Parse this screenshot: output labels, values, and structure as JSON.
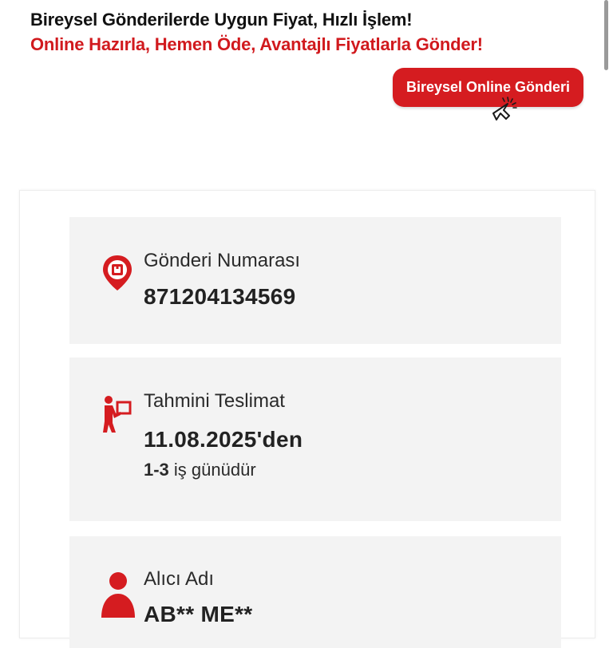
{
  "promo": {
    "title": "Bireysel Gönderilerde Uygun Fiyat, Hızlı İşlem!",
    "subtitle": "Online Hazırla, Hemen Öde, Avantajlı Fiyatlarla Gönder!",
    "cta_label": "Bireysel Online Gönderi"
  },
  "colors": {
    "brand_red": "#d51c20",
    "block_bg": "#f3f3f3"
  },
  "shipment": {
    "number_label": "Gönderi Numarası",
    "number_value": "871204134569",
    "number_icon": "location-pin-icon",
    "delivery_label": "Tahmini Teslimat",
    "delivery_value": "11.08.2025'den",
    "delivery_range": "1-3",
    "delivery_suffix": " iş günüdür",
    "delivery_icon": "courier-icon",
    "recipient_label": "Alıcı Adı",
    "recipient_value": "AB** ME**",
    "recipient_icon": "person-icon"
  }
}
